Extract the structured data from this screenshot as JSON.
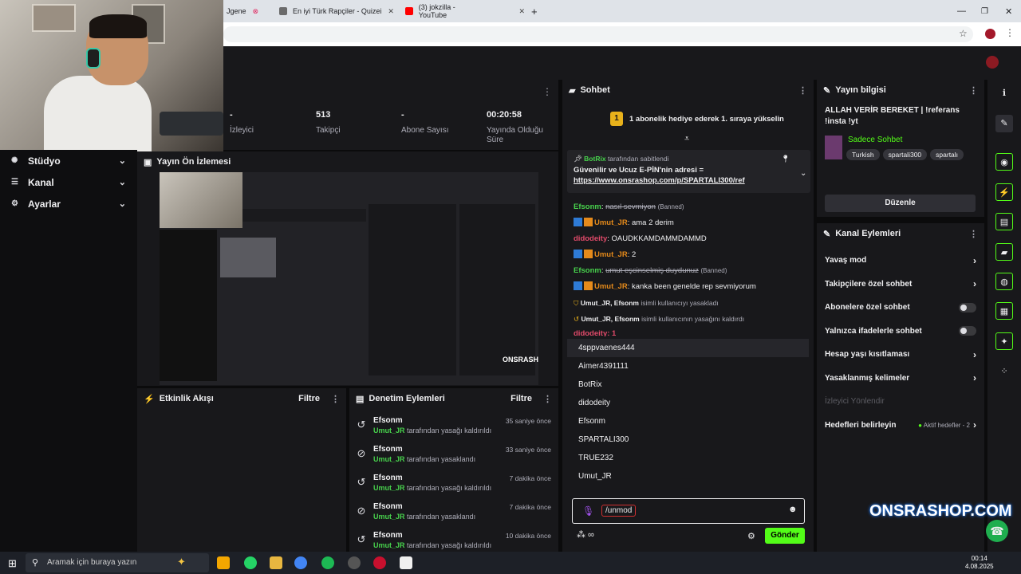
{
  "browser": {
    "tabs": [
      {
        "label": "Jgene",
        "color": "#e0245e"
      },
      {
        "label": "En iyi Türk Rapçiler - Quizei",
        "color": "#6b6b6b"
      },
      {
        "label": "(3) jokzilla - YouTube",
        "color": "#ff0000"
      }
    ],
    "new_tab": "+"
  },
  "sidebar": {
    "items": [
      {
        "label": "Stüdyo",
        "icon": "studio-icon"
      },
      {
        "label": "Kanal",
        "icon": "channel-icon"
      },
      {
        "label": "Ayarlar",
        "icon": "settings-icon"
      }
    ]
  },
  "stats": [
    {
      "value": "-",
      "label": "İzleyici"
    },
    {
      "value": "513",
      "label": "Takipçi"
    },
    {
      "value": "-",
      "label": "Abone Sayısı"
    },
    {
      "value": "00:20:58",
      "label": "Yayında Olduğu Süre"
    }
  ],
  "preview": {
    "title": "Yayın Ön İzlemesi"
  },
  "activity": {
    "title": "Etkinlik Akışı",
    "filter": "Filtre"
  },
  "moderation": {
    "title": "Denetim Eylemleri",
    "filter": "Filtre",
    "items": [
      {
        "user": "Efsonm",
        "target": "Umut_JR",
        "action": "tarafından yasağı kaldırıldı",
        "time": "35 saniye önce",
        "icon": "undo-icon"
      },
      {
        "user": "Efsonm",
        "target": "Umut_JR",
        "action": "tarafından yasaklandı",
        "time": "33 saniye önce",
        "icon": "ban-icon"
      },
      {
        "user": "Efsonm",
        "target": "Umut_JR",
        "action": "tarafından yasağı kaldırıldı",
        "time": "7 dakika önce",
        "icon": "undo-icon"
      },
      {
        "user": "Efsonm",
        "target": "Umut_JR",
        "action": "tarafından yasaklandı",
        "time": "7 dakika önce",
        "icon": "ban-icon"
      },
      {
        "user": "Efsonm",
        "target": "Umut_JR",
        "action": "tarafından yasağı kaldırıldı",
        "time": "10 dakika önce",
        "icon": "undo-icon"
      }
    ]
  },
  "chat": {
    "title": "Sohbet",
    "goal_number": "1",
    "goal_text": "1 abonelik hediye ederek 1. sıraya yükselin",
    "pinned_by": "BotRix",
    "pinned_suffix": "tarafından sabitlendi",
    "pinned_text": "Güvenilir ve Ucuz E-PİN'nin adresi =",
    "pinned_link": "https://www.onsrashop.com/p/SPARTALI300/ref",
    "messages": [
      {
        "user": "Efsonm",
        "text": "nasıl sevmiyon",
        "suffix": "(Banned)"
      },
      {
        "user": "Umut_JR",
        "text": "ama 2 derim"
      },
      {
        "user": "didodeity",
        "text": "OAUDKKAMDAMMDAMMD"
      },
      {
        "user": "Umut_JR",
        "text": "2"
      },
      {
        "user": "Efsonm",
        "text": "umut eşcinselmiş duydunuz",
        "suffix": "(Banned)"
      },
      {
        "user": "Umut_JR",
        "text": "kanka been genelde rep sevmiyorum"
      }
    ],
    "system": [
      {
        "users": "Umut_JR, Efsonm",
        "text": "isimli kullanıcıyı yasakladı"
      },
      {
        "users": "Umut_JR, Efsonm",
        "text": "isimli kullanıcının yasağını kaldırdı"
      }
    ],
    "partial_line": "didodeity: 1",
    "suggestions": [
      "4sppvaenes444",
      "Aimer4391111",
      "BotRix",
      "didodeity",
      "Efsonm",
      "SPARTALI300",
      "TRUE232",
      "Umut_JR"
    ],
    "input_value": "/unmod",
    "send_label": "Gönder"
  },
  "stream_info": {
    "title": "Yayın bilgisi",
    "stream_title": "ALLAH VERİR BEREKET | !referans !insta !yt",
    "category": "Sadece Sohbet",
    "tags": [
      "Turkish",
      "spartali300",
      "spartalı"
    ],
    "edit_label": "Düzenle"
  },
  "channel_actions": {
    "title": "Kanal Eylemleri",
    "items": [
      {
        "label": "Yavaş mod",
        "kind": "chevron"
      },
      {
        "label": "Takipçilere özel sohbet",
        "kind": "chevron"
      },
      {
        "label": "Abonelere özel sohbet",
        "kind": "toggle"
      },
      {
        "label": "Yalnızca ifadelerle sohbet",
        "kind": "toggle"
      },
      {
        "label": "Hesap yaşı kısıtlaması",
        "kind": "chevron"
      },
      {
        "label": "Yasaklanmış kelimeler",
        "kind": "chevron"
      }
    ],
    "disabled_item": "İzleyici Yönlendir",
    "goals_label": "Hedefleri belirleyin",
    "goals_status": "Aktif hedefler - 2"
  },
  "overlay": {
    "brand": "ONSRASHOP.COM"
  },
  "taskbar": {
    "search_placeholder": "Aramak için buraya yazın",
    "time": "00:14",
    "date": "4.08.2025"
  },
  "colors": {
    "accent": "#53fc18",
    "panel": "#18181b",
    "background": "#0b0b0c"
  }
}
